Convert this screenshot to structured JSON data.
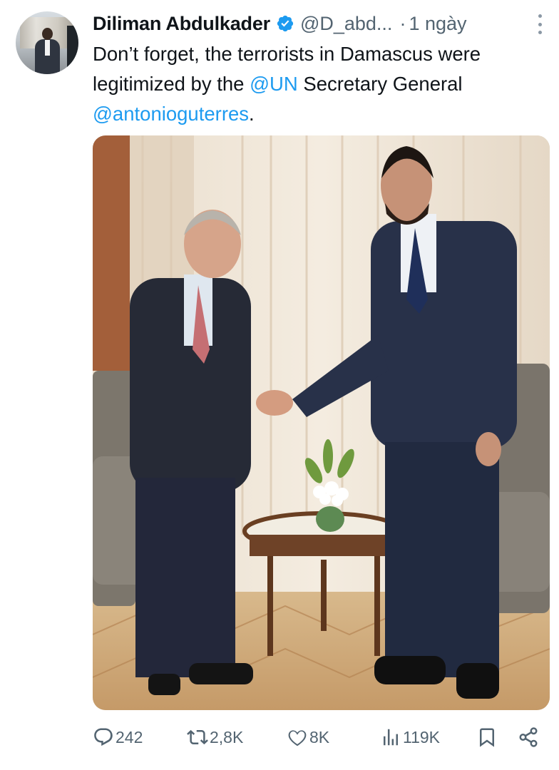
{
  "tweet": {
    "author_name": "Diliman Abdulkader",
    "handle": "@D_abd...",
    "separator": "·",
    "time": "1 ngày",
    "text_part1": "Don’t forget, the terrorists in Damascus were legitimized by the ",
    "mention_un": "@UN",
    "text_part2": " Secretary General ",
    "mention_guterres": "@antonioguterres",
    "text_end": "."
  },
  "actions": {
    "replies": "242",
    "reposts": "2,8K",
    "likes": "8K",
    "views": "119K"
  },
  "icons": {
    "verified": "verified-badge-icon",
    "more": "more-options-icon",
    "reply": "reply-icon",
    "repost": "repost-icon",
    "like": "heart-icon",
    "views": "views-icon",
    "bookmark": "bookmark-icon",
    "share": "share-icon"
  },
  "colors": {
    "link": "#1d9bf0",
    "muted": "#536471",
    "text": "#0f1419"
  }
}
